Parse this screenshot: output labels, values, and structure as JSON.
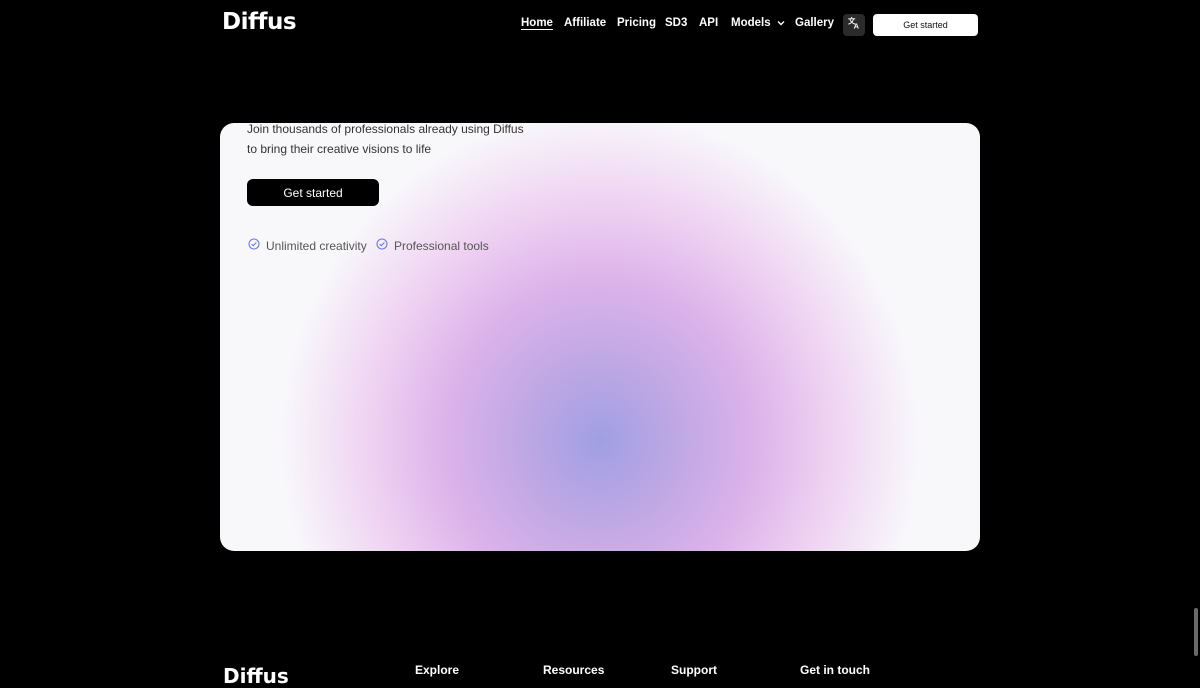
{
  "brand": {
    "name": "Diffus"
  },
  "nav": {
    "items": [
      {
        "label": "Home"
      },
      {
        "label": "Affiliate"
      },
      {
        "label": "Pricing"
      },
      {
        "label": "SD3"
      },
      {
        "label": "API"
      },
      {
        "label": "Models"
      },
      {
        "label": "Gallery"
      }
    ],
    "language_icon": "translate-icon",
    "cta_label": "Get started"
  },
  "hero": {
    "subtitle_line1": "Join thousands of professionals already using Diffus",
    "subtitle_line2": "to bring their creative visions to life",
    "cta_label": "Get started",
    "features": [
      {
        "label": "Unlimited creativity",
        "icon": "check-circle-icon"
      },
      {
        "label": "Professional tools",
        "icon": "check-circle-icon"
      }
    ]
  },
  "footer": {
    "brand": "Diffus",
    "columns": [
      {
        "title": "Explore"
      },
      {
        "title": "Resources"
      },
      {
        "title": "Support"
      },
      {
        "title": "Get in touch"
      }
    ]
  },
  "colors": {
    "background": "#000000",
    "card": "#f8f8fb",
    "gradient_center": "#a09fe4",
    "gradient_outer": "#dcb2ea",
    "feature_icon": "#6b7bd6"
  }
}
